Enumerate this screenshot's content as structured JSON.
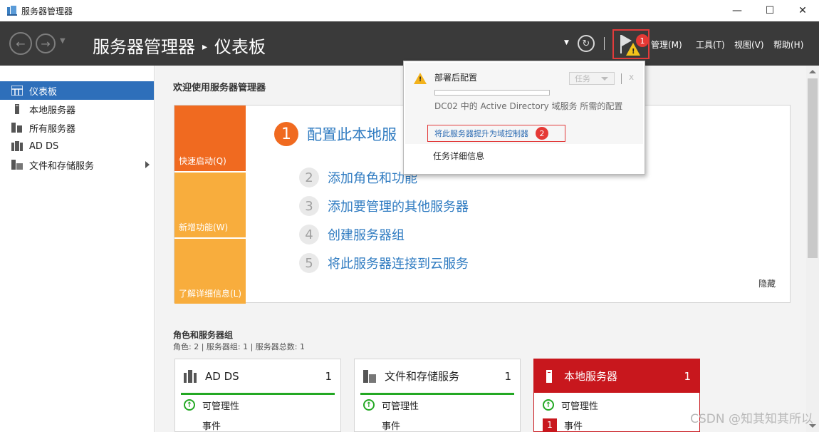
{
  "window": {
    "title": "服务器管理器",
    "controls": {
      "minimize": "—",
      "maximize": "☐",
      "close": "✕"
    }
  },
  "header": {
    "app": "服务器管理器",
    "separator": "▸",
    "page": "仪表板",
    "flag_badge": "1",
    "menus": [
      "管理(M)",
      "工具(T)",
      "视图(V)",
      "帮助(H)"
    ]
  },
  "sidebar": {
    "items": [
      {
        "label": "仪表板",
        "icon": "dashboard-icon",
        "active": true
      },
      {
        "label": "本地服务器",
        "icon": "server-icon"
      },
      {
        "label": "所有服务器",
        "icon": "servers-icon"
      },
      {
        "label": "AD DS",
        "icon": "ad-ds-icon"
      },
      {
        "label": "文件和存储服务",
        "icon": "file-storage-icon",
        "has_submenu": true
      }
    ]
  },
  "main": {
    "welcome_title": "欢迎使用服务器管理器",
    "tiles": [
      "快速启动(Q)",
      "新增功能(W)",
      "了解详细信息(L)"
    ],
    "steps": [
      {
        "num": "1",
        "label": "配置此本地服"
      },
      {
        "num": "2",
        "label": "添加角色和功能"
      },
      {
        "num": "3",
        "label": "添加要管理的其他服务器"
      },
      {
        "num": "4",
        "label": "创建服务器组"
      },
      {
        "num": "5",
        "label": "将此服务器连接到云服务"
      }
    ],
    "hide": "隐藏",
    "roles_title": "角色和服务器组",
    "roles_sub": "角色: 2 | 服务器组: 1 | 服务器总数: 1",
    "cards": [
      {
        "title": "AD DS",
        "count": "1",
        "rows": [
          "可管理性",
          "事件"
        ]
      },
      {
        "title": "文件和存储服务",
        "count": "1",
        "rows": [
          "可管理性",
          "事件"
        ]
      },
      {
        "title": "本地服务器",
        "count": "1",
        "rows": [
          "可管理性",
          "事件"
        ],
        "event_count": "1"
      }
    ]
  },
  "popup": {
    "title": "部署后配置",
    "task_label": "任务",
    "close": "x",
    "description": "DC02 中的 Active Directory 域服务 所需的配置",
    "promote_link": "将此服务器提升为域控制器",
    "promote_badge": "2",
    "details_link": "任务详细信息"
  },
  "watermark": "CSDN @知其知其所以",
  "colors": {
    "header_bg": "#3a3a3a",
    "active_blue": "#2e6fba",
    "orange": "#f06a20",
    "light_orange": "#f8ad3d",
    "link_blue": "#2f7bc1",
    "alert_red": "#c8171d",
    "ok_green": "#23a823"
  }
}
